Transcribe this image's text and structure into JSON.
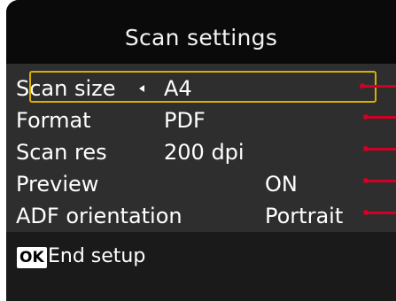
{
  "screen": {
    "title": "Scan settings"
  },
  "settings": [
    {
      "label": "Scan size",
      "value": "A4"
    },
    {
      "label": "Format",
      "value": "PDF"
    },
    {
      "label": "Scan res",
      "value": "200 dpi"
    },
    {
      "label": "Preview",
      "value": "ON"
    },
    {
      "label": "ADF orientation",
      "value": "Portrait"
    }
  ],
  "footer": {
    "ok_key": "OK",
    "action": "End setup"
  },
  "colors": {
    "selection": "#d9b000",
    "callout": "#d10024"
  }
}
